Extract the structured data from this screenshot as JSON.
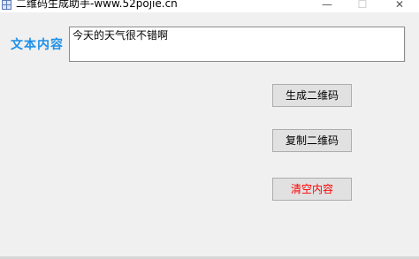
{
  "window": {
    "title": "二维码生成助手-www.52pojie.cn",
    "minimize_glyph": "—",
    "maximize_glyph": "☐",
    "close_glyph": "✕"
  },
  "form": {
    "content_label": "文本内容",
    "content_value": "今天的天气很不错啊"
  },
  "buttons": {
    "generate_label": "生成二维码",
    "copy_label": "复制二维码",
    "clear_label": "清空内容"
  },
  "colors": {
    "label_color": "#1e90e8",
    "clear_text_color": "#ff0000",
    "background": "#f0f0f0"
  },
  "icons": {
    "app": "qr-code-icon"
  }
}
